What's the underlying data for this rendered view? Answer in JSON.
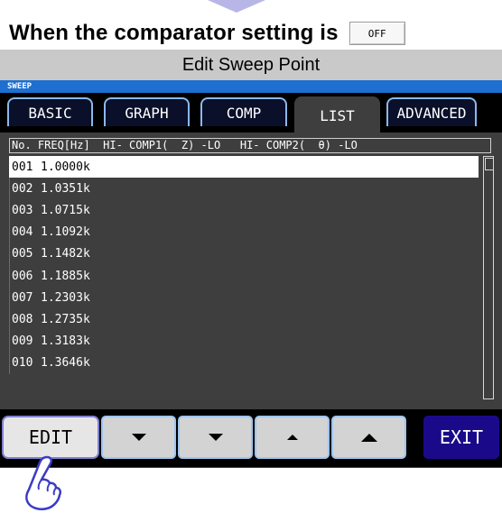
{
  "heading": {
    "text": "When the comparator setting is",
    "badge": "OFF"
  },
  "window": {
    "title": "Edit Sweep Point",
    "mode_label": "SWEEP"
  },
  "tabs": [
    {
      "label": "BASIC",
      "active": false
    },
    {
      "label": "GRAPH",
      "active": false
    },
    {
      "label": "COMP",
      "active": false
    },
    {
      "label": "LIST",
      "active": true
    },
    {
      "label": "ADVANCED",
      "active": false
    }
  ],
  "list": {
    "header": "No. FREQ[Hz]  HI- COMP1(  Z) -LO   HI- COMP2(  θ) -LO",
    "rows": [
      {
        "no": "001",
        "freq": "1.0000k",
        "selected": true
      },
      {
        "no": "002",
        "freq": "1.0351k"
      },
      {
        "no": "003",
        "freq": "1.0715k"
      },
      {
        "no": "004",
        "freq": "1.1092k"
      },
      {
        "no": "005",
        "freq": "1.1482k"
      },
      {
        "no": "006",
        "freq": "1.1885k"
      },
      {
        "no": "007",
        "freq": "1.2303k"
      },
      {
        "no": "008",
        "freq": "1.2735k"
      },
      {
        "no": "009",
        "freq": "1.3183k"
      },
      {
        "no": "010",
        "freq": "1.3646k"
      }
    ]
  },
  "buttons": {
    "edit": "EDIT",
    "exit": "EXIT",
    "icons": [
      "chevron-down-icon",
      "chevron-down-icon",
      "chevron-up-icon",
      "chevron-up-icon"
    ]
  },
  "colors": {
    "screen_bg": "#3e3e3e",
    "sweep_strip": "#1d6fd0",
    "exit_button": "#1a0a8a",
    "tab_border": "#8bb8ea"
  }
}
